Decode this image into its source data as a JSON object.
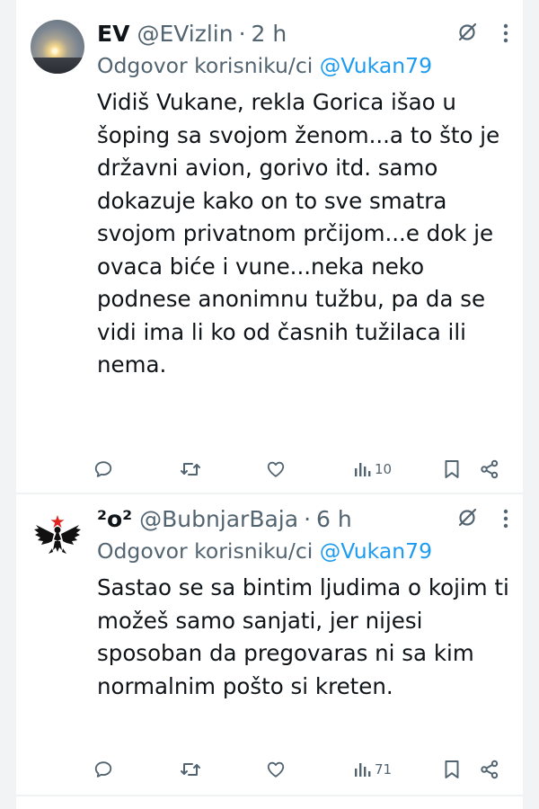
{
  "tweets": [
    {
      "name": "EV",
      "handle": "@EVizlin",
      "dot": "·",
      "time": "2 h",
      "reply_prefix": "Odgovor korisniku/ci",
      "reply_mention": "@Vukan79",
      "text": "Vidiš Vukane, rekla Gorica išao u šoping sa svojom ženom...a to što je državni avion, gorivo itd. samo dokazuje kako on to sve smatra svojom privatnom prčijom...e dok je ovaca biće i vune...neka neko podnese anonimnu tužbu, pa da se vidi ima li ko od časnih tužilaca ili nema.",
      "views": "10"
    },
    {
      "name": "²o²",
      "handle": "@BubnjarBaja",
      "dot": "·",
      "time": "6 h",
      "reply_prefix": "Odgovor korisniku/ci",
      "reply_mention": "@Vukan79",
      "text": "Sastao se sa bintim ljudima o kojim ti možeš samo sanjati, jer nijesi sposoban da pregovaras ni sa kim normalnim pošto si kreten.",
      "views": "71"
    }
  ],
  "colors": {
    "accent": "#1d9bf0",
    "secondary_text": "#536471",
    "star": "#e0231d"
  },
  "icons": [
    "grok-icon",
    "more-icon",
    "reply-icon",
    "retweet-icon",
    "like-icon",
    "views-icon",
    "bookmark-icon",
    "share-icon"
  ]
}
